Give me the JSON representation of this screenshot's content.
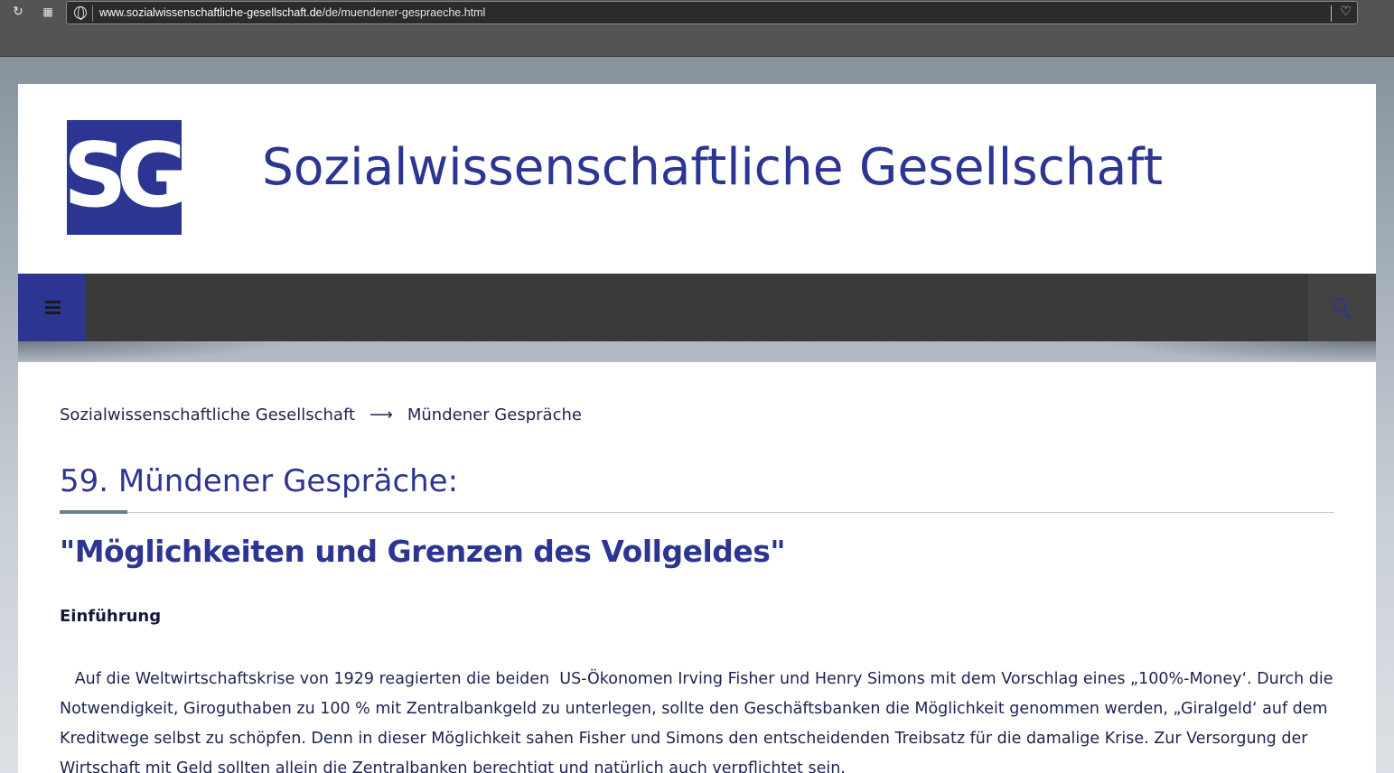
{
  "browser": {
    "url_domain": "www.sozialwissenschaftliche-gesellschaft.de",
    "url_path": "/de/muendener-gespraeche.html"
  },
  "header": {
    "logo_text": "SG",
    "site_title": "Sozialwissenschaftliche Gesellschaft"
  },
  "breadcrumb": {
    "home": "Sozialwissenschaftliche Gesellschaft",
    "arrow": "⟶",
    "current": "Mündener Gespräche"
  },
  "main": {
    "title": "59. Mündener Gespräche:",
    "subtitle": "\"Möglichkeiten und Grenzen des Vollgeldes\"",
    "section_heading": "Einführung",
    "paragraph_lines": [
      "   Auf die Weltwirtschaftskrise von 1929 reagierten die beiden  US-Ökonomen Irving Fisher und Henry Simons mit dem Vorschlag eines „100%-Money‘. Durch die",
      "Notwendigkeit, Giroguthaben zu 100 % mit Zentralbankgeld zu unterlegen, sollte den Geschäftsbanken die Möglichkeit genommen werden, „Giralgeld‘ auf dem",
      "Kreditwege selbst zu schöpfen. Denn in dieser Möglichkeit sahen Fisher und Simons den entscheidenden Treibsatz für die damalige Krise. Zur Versorgung der",
      "Wirtschaft mit Geld sollten allein die Zentralbanken berechtigt und natürlich auch verpflichtet sein."
    ]
  },
  "colors": {
    "brand": "#2d3592",
    "navbar": "#3a3a3a",
    "text": "#1d2350"
  },
  "icons": [
    "reload-icon",
    "apps-icon",
    "globe-icon",
    "heart-icon",
    "menu-icon",
    "search-icon"
  ]
}
